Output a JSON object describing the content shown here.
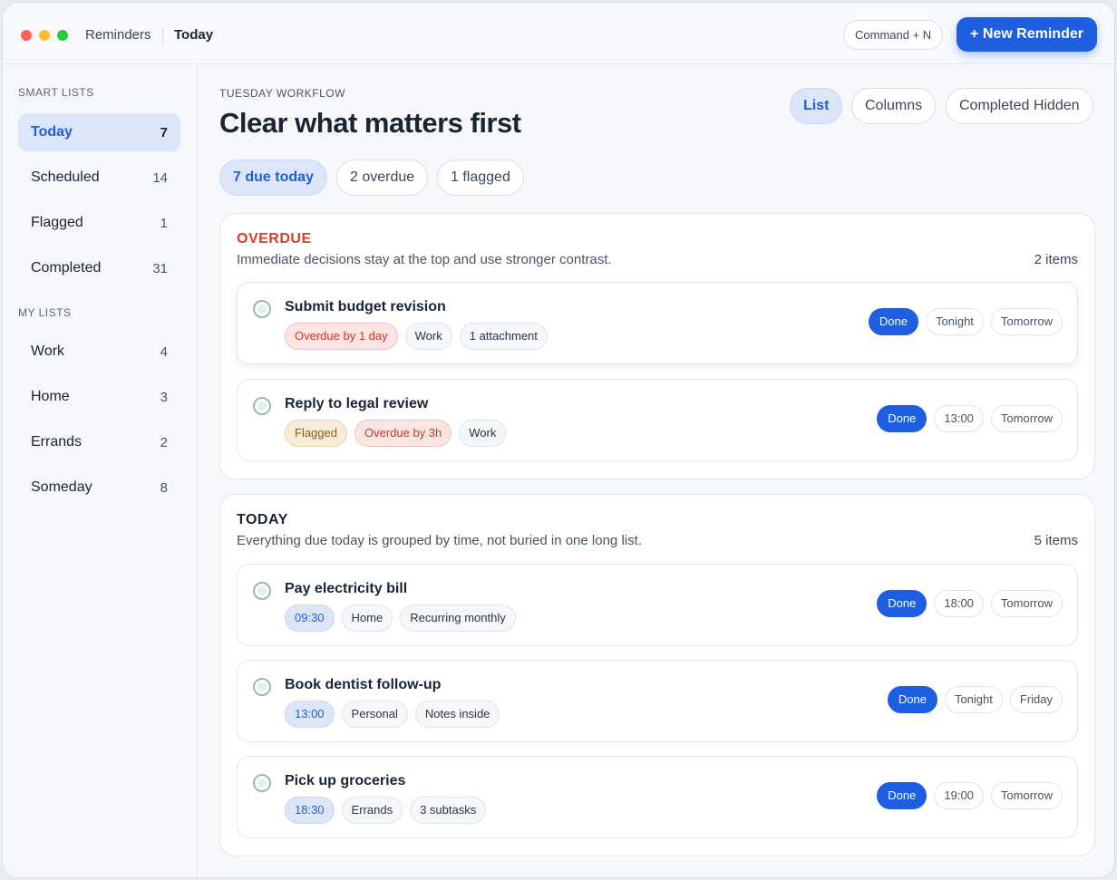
{
  "window": {
    "app_name": "Reminders",
    "current_view": "Today",
    "shortcut": "Command + N",
    "new_button": "+ New Reminder"
  },
  "sidebar": {
    "smart_heading": "SMART LISTS",
    "smart_lists": [
      {
        "label": "Today",
        "count": "7"
      },
      {
        "label": "Scheduled",
        "count": "14"
      },
      {
        "label": "Flagged",
        "count": "1"
      },
      {
        "label": "Completed",
        "count": "31"
      }
    ],
    "my_heading": "MY LISTS",
    "my_lists": [
      {
        "label": "Work",
        "count": "4"
      },
      {
        "label": "Home",
        "count": "3"
      },
      {
        "label": "Errands",
        "count": "2"
      },
      {
        "label": "Someday",
        "count": "8"
      }
    ]
  },
  "main": {
    "eyebrow": "TUESDAY WORKFLOW",
    "headline": "Clear what matters first",
    "views": [
      "List",
      "Columns",
      "Completed Hidden"
    ],
    "filters": [
      "7 due today",
      "2 overdue",
      "1 flagged"
    ]
  },
  "sections": {
    "overdue": {
      "title": "OVERDUE",
      "description": "Immediate decisions stay at the top and use stronger contrast.",
      "count": "2 items",
      "tasks": [
        {
          "title": "Submit budget revision",
          "tags": [
            "Overdue by 1 day",
            "Work",
            "1 attachment"
          ],
          "actions": [
            "Done",
            "Tonight",
            "Tomorrow"
          ]
        },
        {
          "title": "Reply to legal review",
          "tags": [
            "Flagged",
            "Overdue by 3h",
            "Work"
          ],
          "actions": [
            "Done",
            "13:00",
            "Tomorrow"
          ]
        }
      ]
    },
    "today": {
      "title": "TODAY",
      "description": "Everything due today is grouped by time, not buried in one long list.",
      "count": "5 items",
      "tasks": [
        {
          "title": "Pay electricity bill",
          "tags": [
            "09:30",
            "Home",
            "Recurring monthly"
          ],
          "actions": [
            "Done",
            "18:00",
            "Tomorrow"
          ]
        },
        {
          "title": "Book dentist follow-up",
          "tags": [
            "13:00",
            "Personal",
            "Notes inside"
          ],
          "actions": [
            "Done",
            "Tonight",
            "Friday"
          ]
        },
        {
          "title": "Pick up groceries",
          "tags": [
            "18:30",
            "Errands",
            "3 subtasks"
          ],
          "actions": [
            "Done",
            "19:00",
            "Tomorrow"
          ]
        }
      ]
    }
  },
  "colors": {
    "accent": "#1d5fe0",
    "overdue": "#d3402b",
    "flagged": "#8a5a14"
  }
}
